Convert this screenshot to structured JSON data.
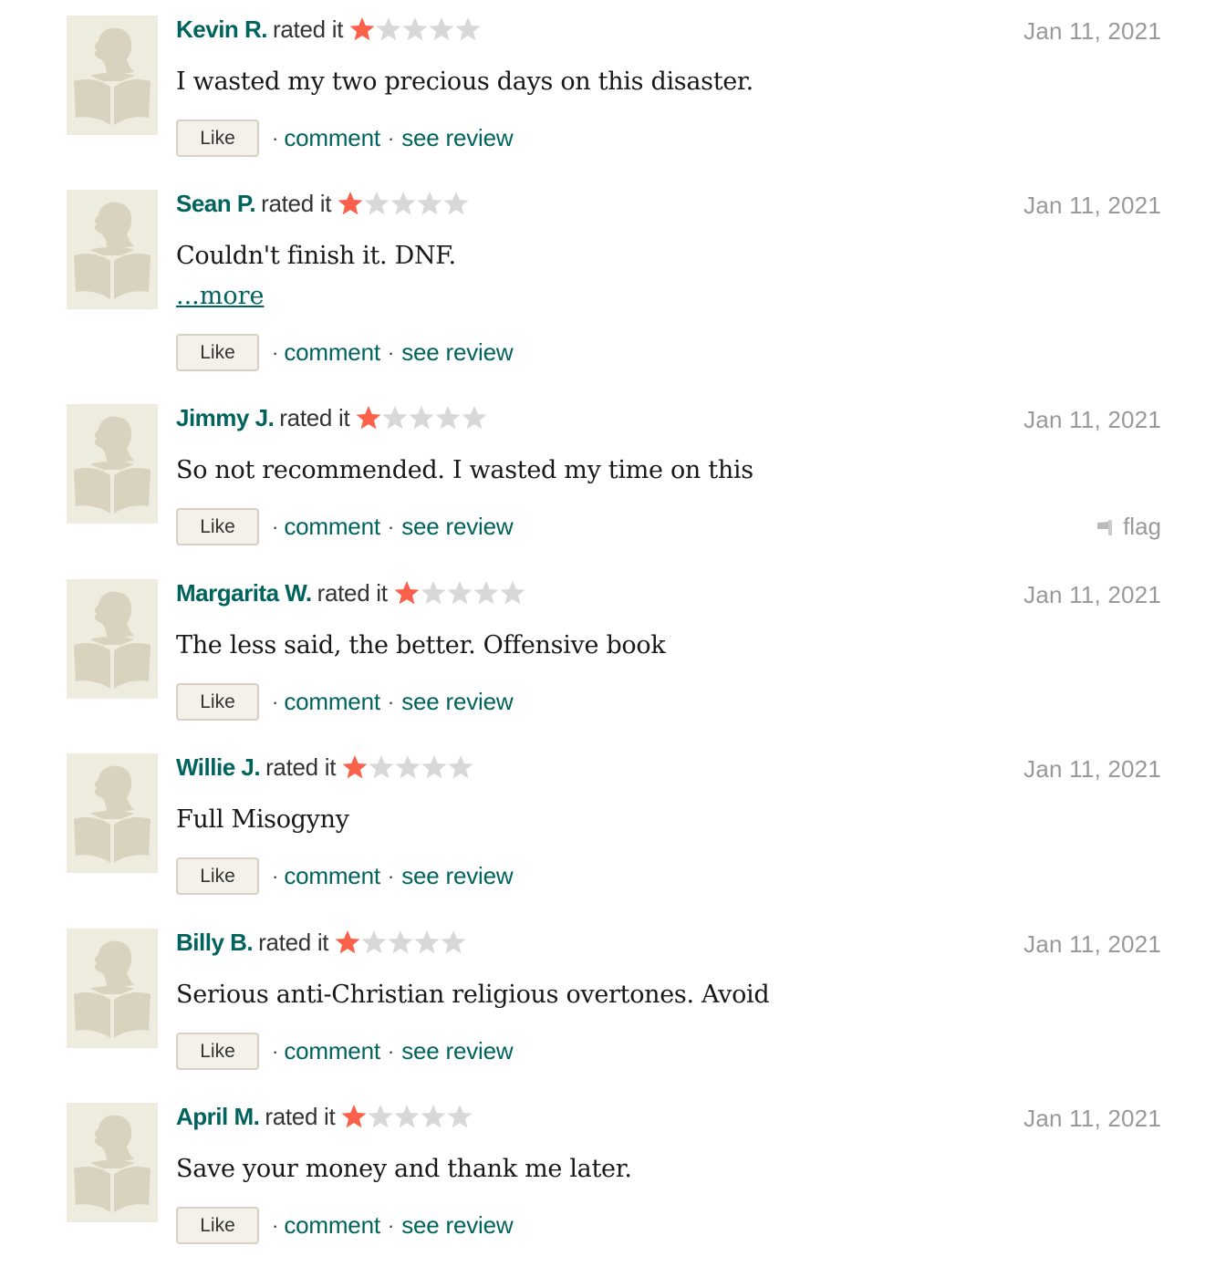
{
  "colors": {
    "link": "#00635d",
    "star_filled": "#fa604a",
    "star_empty": "#d8d8d8",
    "date": "#999999",
    "avatar_bg": "#eeebdf",
    "avatar_fg": "#d9d2bf"
  },
  "labels": {
    "rated_it": "rated it",
    "like": "Like",
    "comment": "comment",
    "see_review": "see review",
    "separator": "·",
    "more": "...more",
    "flag": "flag"
  },
  "reviews": [
    {
      "user": "Kevin R.",
      "rating": 1,
      "max_rating": 5,
      "date": "Jan 11, 2021",
      "text": "I wasted my two precious days on this disaster.",
      "has_more": false,
      "show_flag": false,
      "avatar_icon": "default-reader-avatar"
    },
    {
      "user": "Sean P.",
      "rating": 1,
      "max_rating": 5,
      "date": "Jan 11, 2021",
      "text": "Couldn't finish it. DNF.",
      "has_more": true,
      "show_flag": false,
      "avatar_icon": "default-reader-avatar"
    },
    {
      "user": "Jimmy J.",
      "rating": 1,
      "max_rating": 5,
      "date": "Jan 11, 2021",
      "text": "So not recommended. I wasted my time on this",
      "has_more": false,
      "show_flag": true,
      "avatar_icon": "default-reader-avatar"
    },
    {
      "user": "Margarita W.",
      "rating": 1,
      "max_rating": 5,
      "date": "Jan 11, 2021",
      "text": "The less said, the better. Offensive book",
      "has_more": false,
      "show_flag": false,
      "avatar_icon": "default-reader-avatar"
    },
    {
      "user": "Willie J.",
      "rating": 1,
      "max_rating": 5,
      "date": "Jan 11, 2021",
      "text": "Full Misogyny",
      "has_more": false,
      "show_flag": false,
      "avatar_icon": "default-reader-avatar"
    },
    {
      "user": "Billy B.",
      "rating": 1,
      "max_rating": 5,
      "date": "Jan 11, 2021",
      "text": "Serious anti-Christian religious overtones. Avoid",
      "has_more": false,
      "show_flag": false,
      "avatar_icon": "default-reader-avatar"
    },
    {
      "user": "April M.",
      "rating": 1,
      "max_rating": 5,
      "date": "Jan 11, 2021",
      "text": "Save your money and thank me later.",
      "has_more": false,
      "show_flag": false,
      "avatar_icon": "default-reader-avatar"
    }
  ]
}
